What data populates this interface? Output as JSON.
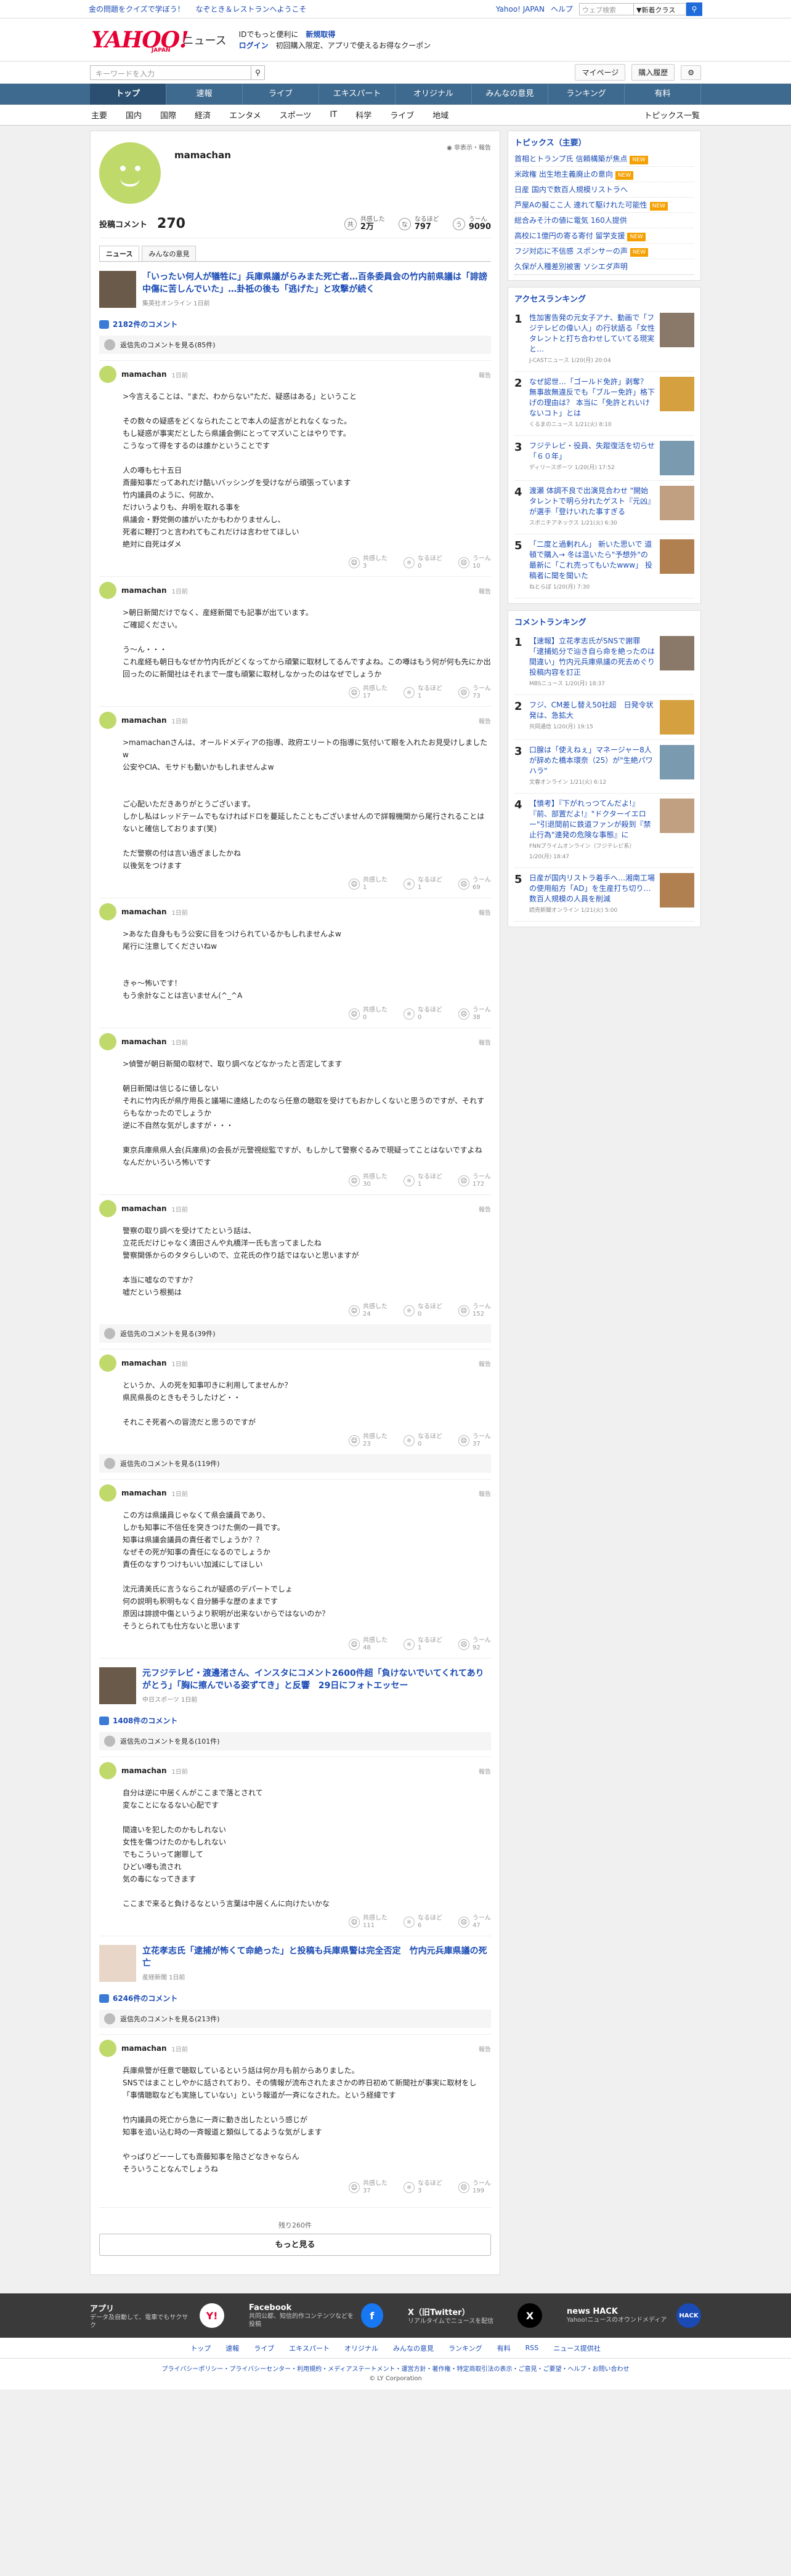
{
  "topstrip": {
    "links": [
      "金の問題をクイズで学ぼう！",
      "なぞとき＆レストランへようこそ"
    ],
    "right_links": [
      "Yahoo! JAPAN",
      "ヘルプ"
    ],
    "search_placeholder": "ウェブ検索",
    "search_scope": "▼新着クラス"
  },
  "header": {
    "logo": "YAHOO!",
    "logo_sub": "JAPAN",
    "section": "ニュース",
    "promo1": "IDでもっと便利に",
    "promo1_link": "新規取得",
    "promo2_login": "ログイン",
    "promo2": "初回購入限定、アプリで使えるお得なクーポン"
  },
  "bar2": {
    "search_placeholder": "キーワードを入力",
    "links": [
      "マイページ",
      "購入履歴"
    ]
  },
  "gnav": [
    "トップ",
    "速報",
    "ライブ",
    "エキスパート",
    "オリジナル",
    "みんなの意見",
    "ランキング",
    "有料"
  ],
  "snav": [
    "主要",
    "国内",
    "国際",
    "経済",
    "エンタメ",
    "スポーツ",
    "IT",
    "科学",
    "ライブ",
    "地域"
  ],
  "snav_more": "トピックス一覧",
  "profile": {
    "name": "mamachan",
    "public": "非表示・報告",
    "comment_label": "投稿コメント",
    "comment_count": "270",
    "stats": [
      {
        "icon": "共",
        "label": "共感した",
        "value": "2万"
      },
      {
        "icon": "な",
        "label": "なるほど",
        "value": "797"
      },
      {
        "icon": "う",
        "label": "うーん",
        "value": "9090"
      }
    ],
    "tabs": [
      "ニュース",
      "みんなの意見"
    ]
  },
  "groups": [
    {
      "title": "「いったい何人が犠牲に」兵庫県議がらみまた死亡者…百条委員会の竹内前県議は「誹謗中傷に苦しんでいた」…卦祗の後も「逃げた」と攻撃が続く",
      "source": "集英社オンライン",
      "age": "1日前",
      "count": "2182件のコメント",
      "replies": "返信先のコメントを見る(85件)",
      "comments": [
        {
          "date": "1日前",
          "text": ">今言えることは、\"まだ、わからない\"ただ、疑惑はある」ということ\n\nその数々の疑惑をどくなられたことで本人の証言がとれなくなった。\nもし疑惑が事実だとしたら県議会側にとってマズいことはやりです。\nこうなって得をするのは誰かということです\n\n人の噂も七十五日\n斎藤知事だってあれだけ酷いバッシングを受けながら頑張っています\n竹内議員のように、何故か、\nだけいうよりも、弁明を取れる事を\n県議会・野党側の誰がいたかもわかりませんし、\n死者に鞭打つと言われてもこれだけは言わせてほしい\n絶対に自死はダメ",
          "s": [
            "3",
            "0",
            "10"
          ]
        },
        {
          "date": "1日前",
          "text": ">朝日新聞だけでなく、産経新聞でも記事が出ています。\nご確認ください。\n\nう〜ん・・・\nこれ産経も朝日もなぜか竹内氏がどくなってから頑繁に取材してるんですよね。この噂はもう何が何も先にか出回ったのに新聞社はそれまで一度も頑繁に取材しなかったのはなぜでしょうか",
          "s": [
            "17",
            "1",
            "73"
          ]
        },
        {
          "date": "1日前",
          "text": ">mamachanさんは、オールドメディアの指導、政府エリートの指導に気付いて眼を入れたお見受けしましたw\n公安やCIA、モサドも動いかもしれませんよw\n\n\nご心配いただきありがとうございます。\nしかし私はレッドテームでもなければドロを蔓延したこともございませんので詳報機関から尾行されることはないと確信しております(笑)\n\nただ警察の付は言い過ぎましたかね\n以後気をつけます",
          "s": [
            "1",
            "1",
            "69"
          ]
        },
        {
          "date": "1日前",
          "text": ">あなた自身ももう公安に目をつけられているかもしれませんよw\n尾行に注意してくださいねw\n\n\nきゃ〜怖いです！\nもう余計なことは言いません(^_^A",
          "s": [
            "0",
            "0",
            "38"
          ]
        },
        {
          "date": "1日前",
          "text": ">偵警が朝日新聞の取材で、取り調べなどなかったと否定してます\n\n朝日新聞は信じるに値しない\nそれに竹内氏が県庁用長と議場に連絡したのなら任意の聴取を受けてもおかしくないと思うのですが、それすらもなかったのでしょうか\n逆に不自然な気がしますが・・・\n\n東京兵庫県県人会(兵庫県)の会長が元警視総監ですが、もしかして警察ぐるみで現疑ってことはないですよね\nなんだかいろいろ怖いです",
          "s": [
            "30",
            "1",
            "172"
          ]
        },
        {
          "date": "1日前",
          "text": "警察の取り調べを受けてたという話は、\n立花氏だけじゃなく清田さんや丸橋洋一氏も言ってましたね\n警察関係からのタタらしいので、立花氏の作り話ではないと思いますが\n\n本当に嘘なのですか？\n嘘だという根拠は",
          "s": [
            "24",
            "0",
            "152"
          ]
        }
      ]
    },
    {
      "title": "",
      "source": "",
      "age": "",
      "count": "",
      "replies": "返信先のコメントを見る(39件)",
      "comments": [
        {
          "date": "1日前",
          "text": "というか、人の死を知事叩きに利用してませんか？\n県民県長のときもそうしたけど・・\n\nそれこそ死者への冒涜だと思うのですが",
          "s": [
            "23",
            "0",
            "37"
          ]
        }
      ]
    },
    {
      "title": "",
      "source": "",
      "age": "",
      "count": "",
      "replies": "返信先のコメントを見る(119件)",
      "comments": [
        {
          "date": "1日前",
          "text": "この方は県議員じゃなくて県会議員であり、\nしかも知事に不信任を突きつけた側の一員です。\n知事は県議会議員の責任者でしょうか？？\nなぜその死が知事の責任になるのでしょうか\n責任のなすりつけもいい加減にしてほしい\n\n沈元清美氏に言うならこれが疑惑のデパートでしょ\n何の説明も釈明もなく自分勝手な歴のままです\n原因は誹謗中傷というより釈明が出来ないからではないのか？\nそうとられても仕方ないと思います",
          "s": [
            "48",
            "1",
            "92"
          ]
        }
      ]
    },
    {
      "title": "元フジテレビ・渡邊渚さん、インスタにコメント2600件超「負けないでいてくれてありがとう」「胸に擦んでいる姿ずてき」と反響　29日にフォトエッセー",
      "source": "中日スポーツ",
      "age": "1日前",
      "count": "1408件のコメント",
      "replies": "返信先のコメントを見る(101件)",
      "comments": [
        {
          "date": "1日前",
          "text": "自分は逆に中居くんがここまで落とされて\n変なことになるない心配です\n\n間違いを犯したのかもしれない\n女性を傷つけたのかもしれない\nでもこういって謝罪して\nひどい噂も流され\n気の毒になってきます\n\nここまで来ると負けるなという言葉は中居くんに向けたいかな",
          "s": [
            "111",
            "6",
            "47"
          ]
        }
      ]
    },
    {
      "title": "立花孝志氏「逮捕が怖くて命絶った」と投稿も兵庫県警は完全否定　竹内元兵庫県議の死亡",
      "source": "産経新聞",
      "age": "1日前",
      "count": "6246件のコメント",
      "replies": "返信先のコメントを見る(213件)",
      "comments": [
        {
          "date": "1日前",
          "text": "兵庫県警が任意で聴取しているという話は何か月も前からありました。\nSNSではまことしやかに話されており、その情報が流布されたまさかの昨日初めて新聞社が事実に取材をし「事情聴取なども実施していない」という報道が一斉になされた。という経緯です\n\n竹内議員の死亡から急に一斉に動き出したという感じが\n知事を追い込む時の一斉報道と類似してるような気がします\n\nやっぱりどーーしても斎藤知事を陥さどなきゃならん\nそういうことなんでしょうね",
          "s": [
            "37",
            "3",
            "199"
          ]
        }
      ]
    }
  ],
  "foot_labels": [
    "共感した",
    "なるほど",
    "うーん"
  ],
  "report": "報告",
  "more": {
    "left": "残り260件",
    "button": "もっと見る"
  },
  "side": {
    "topics_title": "トピックス（主要）",
    "topics": [
      {
        "t": "首相とトランプ氏 信頼構築が焦点",
        "n": true
      },
      {
        "t": "米政権 出生地主義廃止の意向",
        "n": true
      },
      {
        "t": "日産 国内で数百人規模リストラへ",
        "n": false
      },
      {
        "t": "芦屋Aの擬ここ人 連れて駆けれた可能性",
        "n": true
      },
      {
        "t": "総合みそ汁の値に電気 160人提供",
        "n": false
      },
      {
        "t": "高校に1億円の寄る寄付 留学支援",
        "n": true
      },
      {
        "t": "フジ対応に不信感 スポンサーの声",
        "n": true
      },
      {
        "t": "久保が人種差別被害 ソシエダ声明",
        "n": false
      }
    ],
    "rank_title": "アクセスランキング",
    "ranks": [
      {
        "t": "性加害告発の元女子アナ、動画で「フジテレビの偉い人」の行状語る「女性タレントと打ち合わせしていてる現実と…",
        "s": "J-CASTニュース 1/20(月) 20:04"
      },
      {
        "t": "なぜ認世…「ゴールド免許」剥奪？ 無事故無違反でも「ブルー免許」格下げの理由は？ 本当に「免許とれいけないコト」とは",
        "s": "くるまのニュース 1/21(火) 8:10"
      },
      {
        "t": "フジテレビ・役員、失蹤復活を切らせ 「６０年」",
        "s": "ディリースポーツ 1/20(月) 17:52"
      },
      {
        "t": "渡瀬 体調不良で出演見合わせ \"開始タレントで明ら分れたゲスト『元凶』が選手「登けいれた事すぎる",
        "s": "スポニチアネックス 1/21(火) 6:30"
      },
      {
        "t": "「二度と過剰れん」 新いた思いで 道頓で購入→ 冬は温いたら\"予想外\"の 最新に「これ売ってもいたwww」 投稿者に聞を聞いた",
        "s": "ねとらぼ 1/20(月) 7:30"
      }
    ],
    "comrank_title": "コメントランキング",
    "comranks": [
      {
        "t": "【速報】立花孝志氏がSNSで謝罪「逮捕処分で辿き自ら命を絶ったのは間違い」竹内元兵庫県議の死去めぐり投稿内容を訂正",
        "s": "MBSニュース 1/20(月) 18:37"
      },
      {
        "t": "フジ、CM差し替え50社超　日発令状 発は、急拡大",
        "s": "共同通信 1/20(月) 19:15"
      },
      {
        "t": "口腺は「使えねぇ」マネージャー8人が辞めた橋本環奈（25）が\"生絶パワハラ\"",
        "s": "文春オンライン 1/21(火) 6:12"
      },
      {
        "t": "【憤考】『下がれっつてんだよ!』『前、部置だよ!』\"ドクターイエロー\"引退間前に鉄道ファンが殺到『禁止行為\"連発の危険な事態』に",
        "s": "FNNプライムオンライン（フジテレビ系） 1/20(月) 18:47"
      },
      {
        "t": "日産が国内リストラ着手へ…湘南工場の使用船方「AD」を生産打ち切り…数百人規模の人員を削減",
        "s": "読売新聞オンライン 1/21(火) 5:00"
      }
    ]
  },
  "footer": [
    {
      "h": "アプリ",
      "d": "データ及自動して、電車でもサクサク",
      "i": "Y!"
    },
    {
      "h": "Facebook",
      "d": "共同公都、知信的作コンテンツなどを投稿",
      "i": "f"
    },
    {
      "h": "X（旧Twitter）",
      "d": "リアルタイムでニュースを配信",
      "i": "X"
    },
    {
      "h": "news HACK",
      "d": "Yahoo!ニュースのオウンドメディア",
      "i": "HACK"
    }
  ],
  "fnav": [
    "トップ",
    "速報",
    "ライブ",
    "エキスパート",
    "オリジナル",
    "みんなの意見",
    "ランキング",
    "有料",
    "RSS",
    "ニュース提供社"
  ],
  "flinks": "プライバシーポリシー・プライバシーセンター・利用規約・メディアステートメント・運営方針・著作権・特定商取引法の表示・ご意見・ご要望・ヘルプ・お問い合わせ",
  "copyright": "© LY Corporation",
  "colors": {
    "accent": "#1a4bb5",
    "brand": "#e60033",
    "nav": "#3f6a8f",
    "avatar": "#bfd96b"
  }
}
